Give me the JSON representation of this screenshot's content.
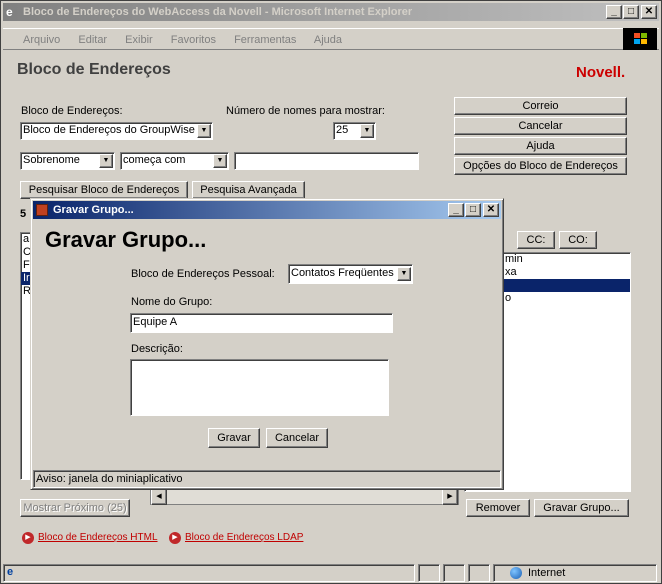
{
  "window": {
    "title": "Bloco de Endereços do WebAccess da Novell - Microsoft Internet Explorer"
  },
  "menu": [
    "Arquivo",
    "Editar",
    "Exibir",
    "Favoritos",
    "Ferramentas",
    "Ajuda"
  ],
  "page": {
    "title": "Bloco de Endereços",
    "brand": "Novell.",
    "addressbook_label": "Bloco de Endereços:",
    "addressbook_value": "Bloco de Endereços do GroupWise",
    "num_label": "Número de nomes para mostrar:",
    "num_value": "25",
    "field_value": "Sobrenome",
    "operator_value": "começa com",
    "search_value": "",
    "tab_search": "Pesquisar Bloco de Endereços",
    "tab_advanced": "Pesquisa Avançada",
    "count_fragment": "5",
    "results_fragments": [
      "a",
      "C",
      "F",
      "Ir",
      "R"
    ],
    "selected_fragment_index": 3,
    "right_list": [
      "min",
      "xa",
      "",
      "o"
    ],
    "cc": "CC:",
    "co": "CO:",
    "show_next": "Mostrar Próximo (25)",
    "remove": "Remover",
    "save_group": "Gravar Grupo...",
    "link_html": "Bloco de Endereços HTML",
    "link_ldap": "Bloco de Endereços LDAP"
  },
  "side_buttons": [
    "Correio",
    "Cancelar",
    "Ajuda",
    "Opções do Bloco de Endereços"
  ],
  "dialog": {
    "title": "Gravar Grupo...",
    "heading": "Gravar Grupo...",
    "personal_label": "Bloco de Endereços Pessoal:",
    "personal_value": "Contatos Freqüentes",
    "group_label": "Nome do Grupo:",
    "group_value": "Equipe A",
    "desc_label": "Descrição:",
    "desc_value": "",
    "save": "Gravar",
    "cancel": "Cancelar",
    "status": "Aviso: janela do miniaplicativo"
  },
  "statusbar": {
    "zone": "Internet"
  },
  "colors": {
    "titlebar": "#0a246a",
    "brand": "#cc0000",
    "selection": "#0a246a"
  }
}
